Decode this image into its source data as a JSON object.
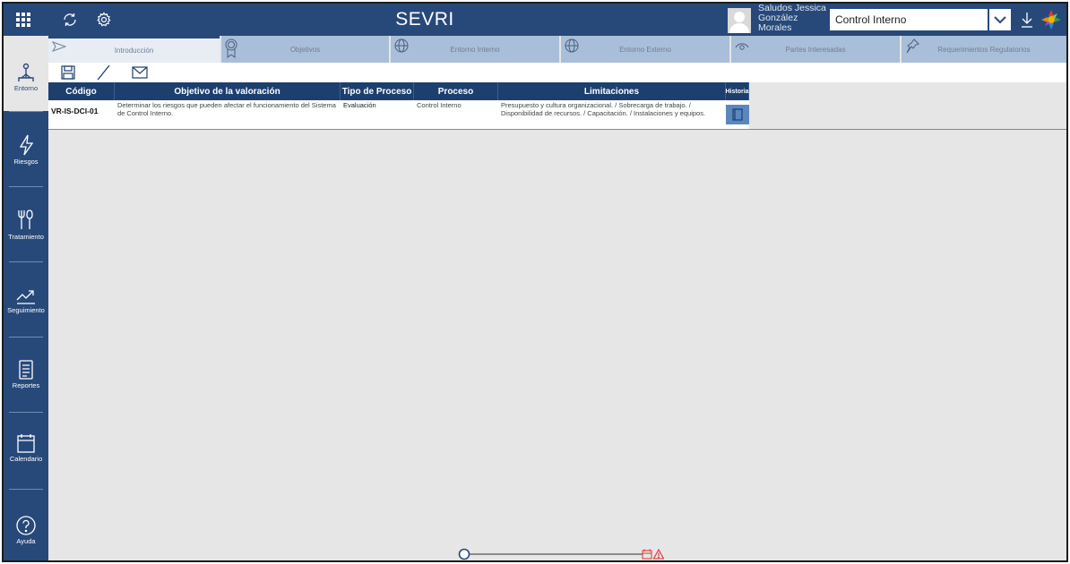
{
  "app": {
    "title": "SEVRI"
  },
  "header": {
    "greeting": "Saludos Jessica González Morales",
    "selected_unit": "Control Interno"
  },
  "sidebar": {
    "items": [
      {
        "label": "Entorno",
        "icon": "hierarchy-icon",
        "active": true
      },
      {
        "label": "Riesgos",
        "icon": "lightning-icon",
        "active": false
      },
      {
        "label": "Tratamiento",
        "icon": "tools-icon",
        "active": false
      },
      {
        "label": "Seguimiento",
        "icon": "trend-icon",
        "active": false
      },
      {
        "label": "Reportes",
        "icon": "document-icon",
        "active": false
      },
      {
        "label": "Calendario",
        "icon": "calendar-icon",
        "active": false
      },
      {
        "label": "Ayuda",
        "icon": "help-icon",
        "active": false
      }
    ]
  },
  "tabs": [
    {
      "label": "Introducción",
      "icon": "send-icon",
      "active": true
    },
    {
      "label": "Objetivos",
      "icon": "badge-icon",
      "active": false
    },
    {
      "label": "Entorno Interno",
      "icon": "globe-icon",
      "active": false
    },
    {
      "label": "Entorno Externo",
      "icon": "globe-icon",
      "active": false
    },
    {
      "label": "Partes Interesadas",
      "icon": "eye-icon",
      "active": false
    },
    {
      "label": "Requerimientos Regulatorios",
      "icon": "pin-icon",
      "active": false
    }
  ],
  "toolbar": {
    "icons": [
      "save-icon",
      "edit-icon",
      "mail-icon"
    ]
  },
  "table": {
    "headers": [
      "Código",
      "Objetivo de la valoración",
      "Tipo de Proceso",
      "Proceso",
      "Limitaciones",
      "Historia"
    ],
    "rows": [
      {
        "codigo": "VR-IS-DCI-01",
        "objetivo": "Determinar los riesgos que pueden afectar el funcionamiento del Sistema de Control Interno.",
        "tipo": "Evaluación",
        "proceso": "Control Interno",
        "limitaciones": "Presupuesto y cultura organizacional. / Sobrecarga de trabajo. / Disponibilidad de recursos. / Capacitación. / Instalaciones y equipos."
      }
    ]
  },
  "colors": {
    "primary": "#27497a",
    "header": "#1c3f6e",
    "tab": "#a9bed8",
    "alert": "#e03030"
  }
}
